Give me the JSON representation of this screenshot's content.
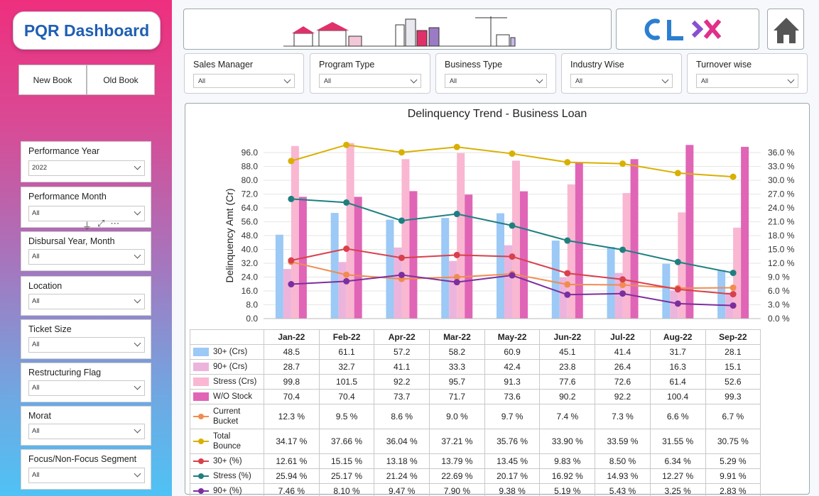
{
  "dashboard": {
    "title": "PQR Dashboard",
    "new_book": "New Book",
    "old_book": "Old Book",
    "logo": "CLX"
  },
  "slicers": [
    {
      "label": "Performance Year",
      "value": "2022"
    },
    {
      "label": "Performance Month",
      "value": "All"
    },
    {
      "label": "Disbursal Year, Month",
      "value": "All"
    },
    {
      "label": "Location",
      "value": "All"
    },
    {
      "label": "Ticket Size",
      "value": "All"
    },
    {
      "label": "Restructuring Flag",
      "value": "All"
    },
    {
      "label": "Morat",
      "value": "All"
    },
    {
      "label": "Focus/Non-Focus Segment",
      "value": "All"
    }
  ],
  "filters": [
    {
      "label": "Sales Manager",
      "value": "All"
    },
    {
      "label": "Program Type",
      "value": "All"
    },
    {
      "label": "Business Type",
      "value": "All"
    },
    {
      "label": "Industry Wise",
      "value": "All"
    },
    {
      "label": "Turnover wise",
      "value": "All"
    }
  ],
  "colors": {
    "brand_blue": "#1f5fb3",
    "logo_blue": "#2b7fd0",
    "logo_pink": "#e0308a",
    "bar_30": "#9cc9f5",
    "bar_90": "#ecb4dc",
    "bar_stress": "#f9b7d2",
    "bar_wo": "#e065b6",
    "line_current": "#f08c50",
    "line_bounce": "#d9b000",
    "line_30p": "#d8404c",
    "line_stress": "#1f7f80",
    "line_90p": "#7b2f9e"
  },
  "chart_data": {
    "type": "bar",
    "title": "Delinquency Trend - Business Loan",
    "ylabel": "Delinquency Amt (Cr)",
    "categories": [
      "Jan-22",
      "Feb-22",
      "Apr-22",
      "Mar-22",
      "May-22",
      "Jun-22",
      "Jul-22",
      "Aug-22",
      "Sep-22"
    ],
    "ylim": [
      0,
      96
    ],
    "y_ticks": [
      "0.0",
      "8.0",
      "16.0",
      "24.0",
      "32.0",
      "40.0",
      "48.0",
      "56.0",
      "64.0",
      "72.0",
      "80.0",
      "88.0",
      "96.0"
    ],
    "y2lim": [
      0,
      36
    ],
    "y2_ticks": [
      "0.0 %",
      "3.0 %",
      "6.0 %",
      "9.0 %",
      "12.0 %",
      "15.0 %",
      "18.0 %",
      "21.0 %",
      "24.0 %",
      "27.0 %",
      "30.0 %",
      "33.0 %",
      "36.0 %"
    ],
    "bar_series": [
      {
        "name": "30+ (Crs)",
        "color": "#9cc9f5",
        "values": [
          48.5,
          61.1,
          57.2,
          58.2,
          60.9,
          45.1,
          41.4,
          31.7,
          28.1
        ],
        "display": [
          "48.5",
          "61.1",
          "57.2",
          "58.2",
          "60.9",
          "45.1",
          "41.4",
          "31.7",
          "28.1"
        ]
      },
      {
        "name": "90+ (Crs)",
        "color": "#ecb4dc",
        "values": [
          28.7,
          32.7,
          41.1,
          33.3,
          42.4,
          23.8,
          26.4,
          16.3,
          15.1
        ],
        "display": [
          "28.7",
          "32.7",
          "41.1",
          "33.3",
          "42.4",
          "23.8",
          "26.4",
          "16.3",
          "15.1"
        ]
      },
      {
        "name": "Stress (Crs)",
        "color": "#f9b7d2",
        "values": [
          99.8,
          101.5,
          92.2,
          95.7,
          91.3,
          77.6,
          72.6,
          61.4,
          52.6
        ],
        "display": [
          "99.8",
          "101.5",
          "92.2",
          "95.7",
          "91.3",
          "77.6",
          "72.6",
          "61.4",
          "52.6"
        ]
      },
      {
        "name": "W/O Stock",
        "color": "#e065b6",
        "values": [
          70.4,
          70.4,
          73.7,
          71.7,
          73.6,
          90.2,
          92.2,
          100.4,
          99.3
        ],
        "display": [
          "70.4",
          "70.4",
          "73.7",
          "71.7",
          "73.6",
          "90.2",
          "92.2",
          "100.4",
          "99.3"
        ]
      }
    ],
    "line_series": [
      {
        "name": "Current Bucket",
        "color": "#f08c50",
        "values": [
          12.3,
          9.5,
          8.6,
          9.0,
          9.7,
          7.4,
          7.3,
          6.6,
          6.7
        ],
        "display": [
          "12.3 %",
          "9.5 %",
          "8.6 %",
          "9.0 %",
          "9.7 %",
          "7.4 %",
          "7.3 %",
          "6.6 %",
          "6.7 %"
        ]
      },
      {
        "name": "Total Bounce",
        "color": "#d9b000",
        "values": [
          34.17,
          37.66,
          36.04,
          37.21,
          35.76,
          33.9,
          33.59,
          31.55,
          30.75
        ],
        "display": [
          "34.17 %",
          "37.66 %",
          "36.04 %",
          "37.21 %",
          "35.76 %",
          "33.90 %",
          "33.59 %",
          "31.55 %",
          "30.75 %"
        ]
      },
      {
        "name": "30+ (%)",
        "color": "#d8404c",
        "values": [
          12.61,
          15.15,
          13.18,
          13.79,
          13.45,
          9.83,
          8.5,
          6.34,
          5.29
        ],
        "display": [
          "12.61 %",
          "15.15 %",
          "13.18 %",
          "13.79 %",
          "13.45 %",
          "9.83 %",
          "8.50 %",
          "6.34 %",
          "5.29 %"
        ]
      },
      {
        "name": "Stress (%)",
        "color": "#1f7f80",
        "values": [
          25.94,
          25.17,
          21.24,
          22.69,
          20.17,
          16.92,
          14.93,
          12.27,
          9.91
        ],
        "display": [
          "25.94 %",
          "25.17 %",
          "21.24 %",
          "22.69 %",
          "20.17 %",
          "16.92 %",
          "14.93 %",
          "12.27 %",
          "9.91 %"
        ]
      },
      {
        "name": "90+ (%)",
        "color": "#7b2f9e",
        "values": [
          7.46,
          8.1,
          9.47,
          7.9,
          9.38,
          5.19,
          5.43,
          3.25,
          2.83
        ],
        "display": [
          "7.46 %",
          "8.10 %",
          "9.47 %",
          "7.90 %",
          "9.38 %",
          "5.19 %",
          "5.43 %",
          "3.25 %",
          "2.83 %"
        ]
      }
    ]
  }
}
